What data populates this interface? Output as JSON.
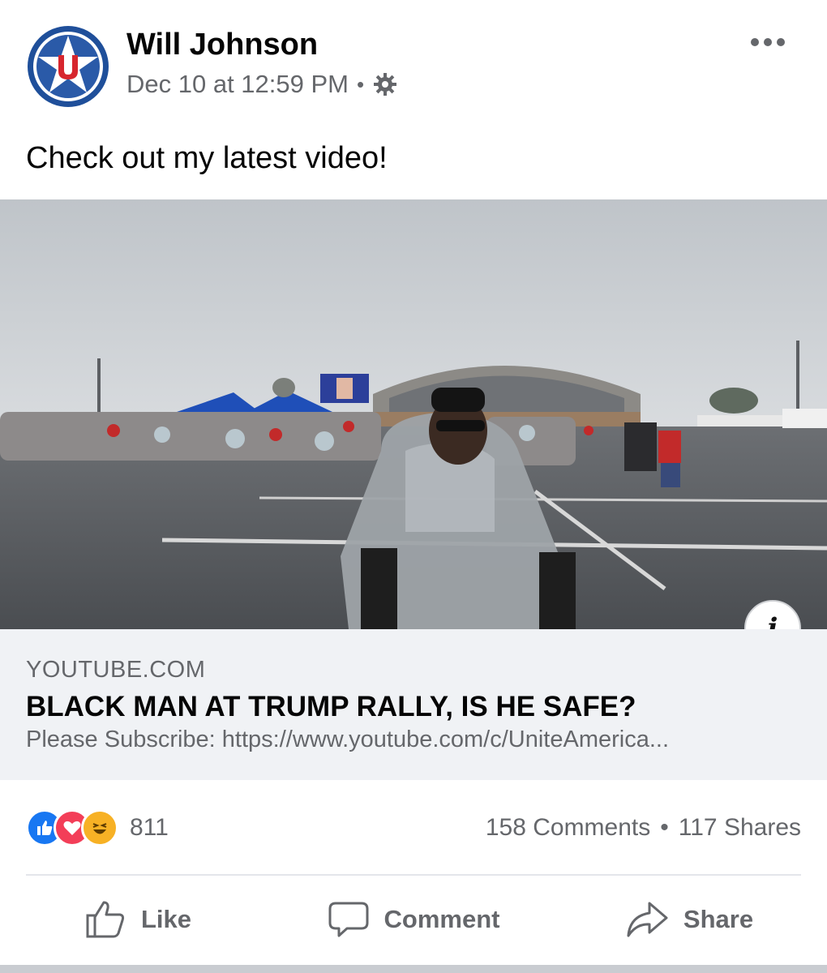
{
  "post": {
    "author": "Will Johnson",
    "date": "Dec 10 at 12:59 PM",
    "privacy_icon": "gear-icon",
    "more_icon": "more-options-icon",
    "text": "Check out my latest video!"
  },
  "link_card": {
    "domain": "YOUTUBE.COM",
    "title": "BLACK MAN AT TRUMP RALLY, IS HE SAFE?",
    "description": "Please Subscribe: https://www.youtube.com/c/UniteAmerica..."
  },
  "engagement": {
    "reaction_icons": [
      "like-icon",
      "love-icon",
      "haha-icon"
    ],
    "reaction_count": "811",
    "comments": "158 Comments",
    "separator": "•",
    "shares": "117 Shares"
  },
  "actions": {
    "like": "Like",
    "comment": "Comment",
    "share": "Share"
  },
  "colors": {
    "like_blue": "#1877f2",
    "love_red": "#f33e58",
    "haha_yellow": "#f7b125",
    "secondary_text": "#65676b",
    "card_bg": "#f0f2f5"
  }
}
